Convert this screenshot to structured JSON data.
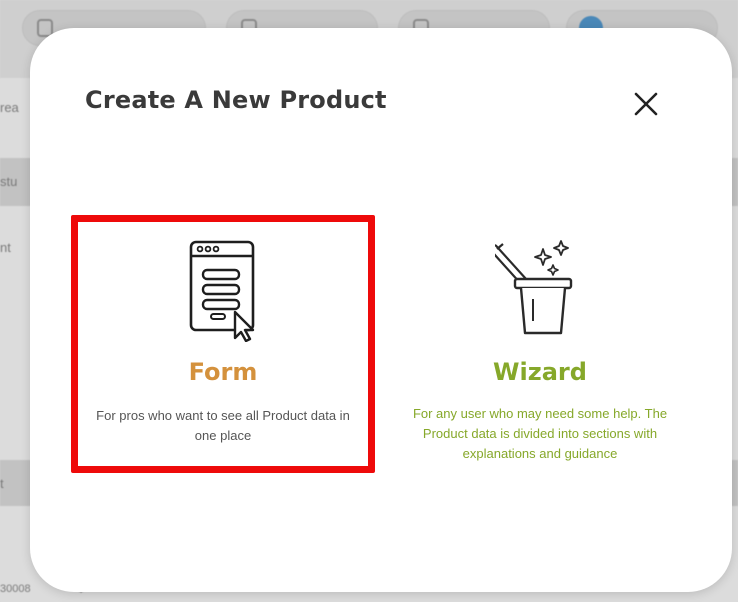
{
  "modal": {
    "title": "Create A New Product",
    "close_icon": "close-icon",
    "options": [
      {
        "id": "form",
        "icon": "form-document-icon",
        "title": "Form",
        "description": "For pros who want to see all Product data in one place",
        "selected": true,
        "title_color": "#d4913c"
      },
      {
        "id": "wizard",
        "icon": "magic-wand-hat-icon",
        "title": "Wizard",
        "description": "For any user who may need some help. The Product data is divided into sections with explanations and guidance",
        "selected": false,
        "title_color": "#86a82a"
      }
    ]
  },
  "background": {
    "partial_texts": [
      "rea",
      "stu",
      "nt",
      "t",
      "30008",
      "$—"
    ]
  },
  "colors": {
    "selection_border": "#ee0a0a",
    "form_accent": "#d4913c",
    "wizard_accent": "#86a82a",
    "title_text": "#3a3a3a"
  }
}
